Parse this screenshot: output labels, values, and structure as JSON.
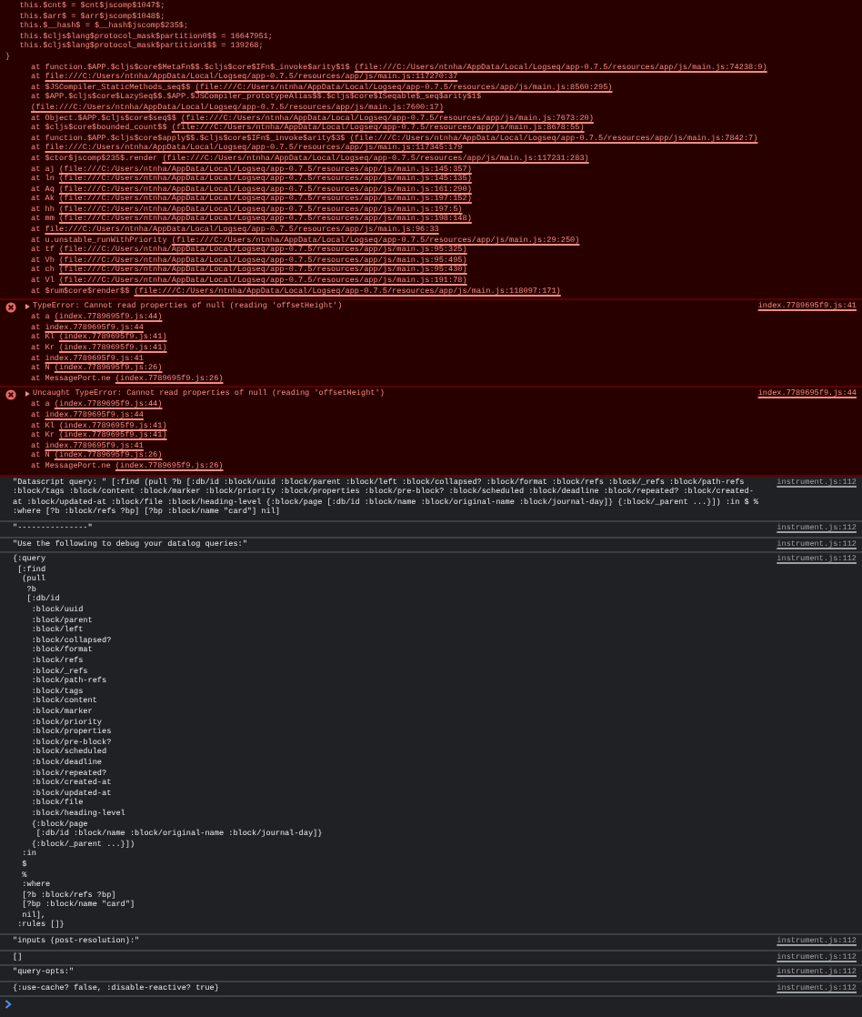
{
  "console": {
    "messages": [
      {
        "kind": "error",
        "lines": [
          "   this.$cnt$ = $cnt$jscomp$1047$;",
          "   this.$arr$ = $arr$jscomp$1048$;",
          "   this.$__hash$ = $__hash$jscomp$235$;",
          "   this.$cljs$lang$protocol_mask$partition0$$ = 16647951;",
          "   this.$cljs$lang$protocol_mask$partition1$$ = 139268;",
          "}"
        ],
        "frames": [
          {
            "call": "at function.$APP.$cljs$core$MetaFn$$.$cljs$core$IFn$_invoke$arity$1$",
            "location": "(file:///C:/Users/ntnha/AppData/Local/Logseq/app-0.7.5/resources/app/js/main.js:74238:9)"
          },
          {
            "call": "at",
            "location": "file:///C:/Users/ntnha/AppData/Local/Logseq/app-0.7.5/resources/app/js/main.js:117270:37"
          },
          {
            "call": "at $JSCompiler_StaticMethods_seq$$",
            "location": "(file:///C:/Users/ntnha/AppData/Local/Logseq/app-0.7.5/resources/app/js/main.js:8560:295)"
          },
          {
            "call": "at $APP.$cljs$core$LazySeq$$.$APP.$JSCompiler_prototypeAlias$$.$cljs$core$ISeqable$_seq$arity$1$",
            "location": "(file:///C:/Users/ntnha/AppData/Local/Logseq/app-0.7.5/resources/app/js/main.js:7600:17)"
          },
          {
            "call": "at Object.$APP.$cljs$core$seq$$",
            "location": "(file:///C:/Users/ntnha/AppData/Local/Logseq/app-0.7.5/resources/app/js/main.js:7673:20)"
          },
          {
            "call": "at $cljs$core$bounded_count$$",
            "location": "(file:///C:/Users/ntnha/AppData/Local/Logseq/app-0.7.5/resources/app/js/main.js:8678:55)"
          },
          {
            "call": "at function.$APP.$cljs$core$apply$$.$cljs$core$IFn$_invoke$arity$3$",
            "location": "(file:///C:/Users/ntnha/AppData/Local/Logseq/app-0.7.5/resources/app/js/main.js:7842:7)"
          },
          {
            "call": "at",
            "location": "file:///C:/Users/ntnha/AppData/Local/Logseq/app-0.7.5/resources/app/js/main.js:117345:179"
          },
          {
            "call": "at $ctor$jscomp$235$.render",
            "location": "(file:///C:/Users/ntnha/AppData/Local/Logseq/app-0.7.5/resources/app/js/main.js:117231:283)"
          },
          {
            "call": "at aj",
            "location": "(file:///C:/Users/ntnha/AppData/Local/Logseq/app-0.7.5/resources/app/js/main.js:145:357)"
          },
          {
            "call": "at ln",
            "location": "(file:///C:/Users/ntnha/AppData/Local/Logseq/app-0.7.5/resources/app/js/main.js:145:135)"
          },
          {
            "call": "at Aq",
            "location": "(file:///C:/Users/ntnha/AppData/Local/Logseq/app-0.7.5/resources/app/js/main.js:161:290)"
          },
          {
            "call": "at Ak",
            "location": "(file:///C:/Users/ntnha/AppData/Local/Logseq/app-0.7.5/resources/app/js/main.js:197:152)"
          },
          {
            "call": "at hh",
            "location": "(file:///C:/Users/ntnha/AppData/Local/Logseq/app-0.7.5/resources/app/js/main.js:197:5)"
          },
          {
            "call": "at mm",
            "location": "(file:///C:/Users/ntnha/AppData/Local/Logseq/app-0.7.5/resources/app/js/main.js:198:148)"
          },
          {
            "call": "at",
            "location": "file:///C:/Users/ntnha/AppData/Local/Logseq/app-0.7.5/resources/app/js/main.js:96:33"
          },
          {
            "call": "at u.unstable_runWithPriority",
            "location": "(file:///C:/Users/ntnha/AppData/Local/Logseq/app-0.7.5/resources/app/js/main.js:29:250)"
          },
          {
            "call": "at tf",
            "location": "(file:///C:/Users/ntnha/AppData/Local/Logseq/app-0.7.5/resources/app/js/main.js:95:325)"
          },
          {
            "call": "at Vh",
            "location": "(file:///C:/Users/ntnha/AppData/Local/Logseq/app-0.7.5/resources/app/js/main.js:95:495)"
          },
          {
            "call": "at ch",
            "location": "(file:///C:/Users/ntnha/AppData/Local/Logseq/app-0.7.5/resources/app/js/main.js:95:430)"
          },
          {
            "call": "at Vl",
            "location": "(file:///C:/Users/ntnha/AppData/Local/Logseq/app-0.7.5/resources/app/js/main.js:191:78)"
          },
          {
            "call": "at $rum$core$render$$",
            "location": "(file:///C:/Users/ntnha/AppData/Local/Logseq/app-0.7.5/resources/app/js/main.js:118097:171)"
          }
        ]
      },
      {
        "kind": "error",
        "text": "TypeError: Cannot read properties of null (reading 'offsetHeight')",
        "source": "index.7789695f9.js:41",
        "frames": [
          {
            "call": "at a",
            "location": "(index.7789695f9.js:44)"
          },
          {
            "call": "at",
            "location": "index.7789695f9.js:44"
          },
          {
            "call": "at Kl",
            "location": "(index.7789695f9.js:41)"
          },
          {
            "call": "at Kr",
            "location": "(index.7789695f9.js:41)"
          },
          {
            "call": "at",
            "location": "index.7789695f9.js:41"
          },
          {
            "call": "at N",
            "location": "(index.7789695f9.js:26)"
          },
          {
            "call": "at MessagePort.ne",
            "location": "(index.7789695f9.js:26)"
          }
        ]
      },
      {
        "kind": "error",
        "text": "Uncaught TypeError: Cannot read properties of null (reading 'offsetHeight')",
        "source": "index.7789695f9.js:44",
        "frames": [
          {
            "call": "at a",
            "location": "(index.7789695f9.js:44)"
          },
          {
            "call": "at",
            "location": "index.7789695f9.js:44"
          },
          {
            "call": "at Kl",
            "location": "(index.7789695f9.js:41)"
          },
          {
            "call": "at Kr",
            "location": "(index.7789695f9.js:41)"
          },
          {
            "call": "at",
            "location": "index.7789695f9.js:41"
          },
          {
            "call": "at N",
            "location": "(index.7789695f9.js:26)"
          },
          {
            "call": "at MessagePort.ne",
            "location": "(index.7789695f9.js:26)"
          }
        ]
      },
      {
        "kind": "log",
        "text": "\"Datascript query: \" [:find (pull ?b [:db/id :block/uuid :block/parent :block/left :block/collapsed? :block/format :block/refs :block/_refs :block/path-refs :block/tags :block/content :block/marker :block/priority :block/properties :block/pre-block? :block/scheduled :block/deadline :block/repeated? :block/created-at :block/updated-at :block/file :block/heading-level {:block/page [:db/id :block/name :block/original-name :block/journal-day]} {:block/_parent ...}]) :in $ % :where [?b :block/refs ?bp] [?bp :block/name \"card\"] nil]",
        "source": "instrument.js:112"
      },
      {
        "kind": "log",
        "text": "\"---------------\"",
        "source": "instrument.js:112"
      },
      {
        "kind": "log",
        "text": "\"Use the following to debug your datalog queries:\"",
        "source": "instrument.js:112"
      },
      {
        "kind": "log",
        "lines": [
          "{:query",
          " [:find",
          "  (pull",
          "   ?b",
          "   [:db/id",
          "    :block/uuid",
          "    :block/parent",
          "    :block/left",
          "    :block/collapsed?",
          "    :block/format",
          "    :block/refs",
          "    :block/_refs",
          "    :block/path-refs",
          "    :block/tags",
          "    :block/content",
          "    :block/marker",
          "    :block/priority",
          "    :block/properties",
          "    :block/pre-block?",
          "    :block/scheduled",
          "    :block/deadline",
          "    :block/repeated?",
          "    :block/created-at",
          "    :block/updated-at",
          "    :block/file",
          "    :block/heading-level",
          "    {:block/page",
          "     [:db/id :block/name :block/original-name :block/journal-day]}",
          "    {:block/_parent ...}])",
          "  :in",
          "  $",
          "  %",
          "  :where",
          "  [?b :block/refs ?bp]",
          "  [?bp :block/name \"card\"]",
          "  nil],",
          " :rules []}"
        ],
        "source": "instrument.js:112"
      },
      {
        "kind": "log",
        "text": "\"inputs (post-resolution):\"",
        "source": "instrument.js:112"
      },
      {
        "kind": "log",
        "text": "[]",
        "source": "instrument.js:112"
      },
      {
        "kind": "log",
        "text": "\"query-opts:\"",
        "source": "instrument.js:112"
      },
      {
        "kind": "log",
        "text": "{:use-cache? false, :disable-reactive? true}",
        "source": "instrument.js:112"
      }
    ]
  }
}
